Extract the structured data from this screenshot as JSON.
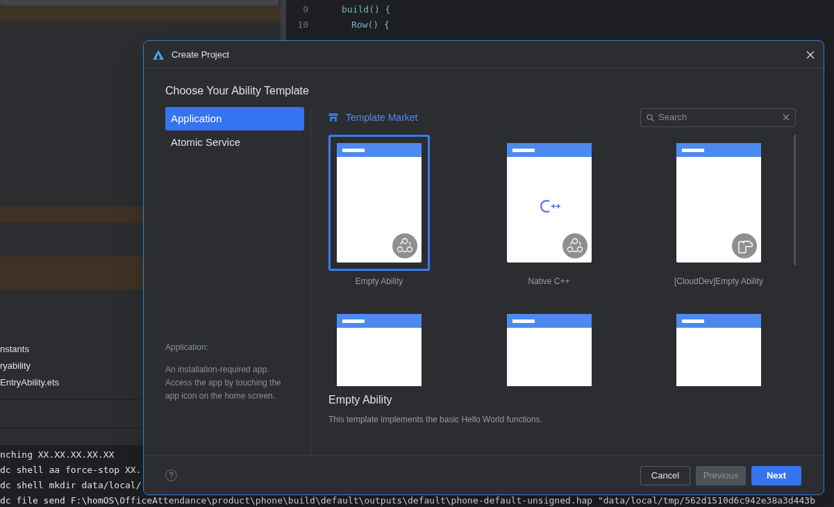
{
  "ide": {
    "editor_lines": [
      {
        "number": "9",
        "code": "build() {",
        "children": [
          {
            "number": "10",
            "code": "Row() {"
          }
        ]
      }
    ],
    "tree_items": [
      "nstants",
      "ryability",
      "EntryAbility.ets"
    ],
    "console_lines": [
      "nching XX.XX.XX.XX.XX",
      "dc shell aa force-stop XX.",
      "dc shell mkdir data/local/",
      "dc file send F:\\homOS\\OfficeAttendance\\product\\phone\\build\\default\\outputs\\default\\phone-default-unsigned.hap \"data/local/tmp/562d1510d6c942e38a3d443b"
    ]
  },
  "dialog": {
    "title": "Create Project",
    "heading": "Choose Your Ability Template",
    "categories": [
      {
        "label": "Application",
        "selected": true
      },
      {
        "label": "Atomic Service",
        "selected": false
      }
    ],
    "category_info": {
      "title": "Application:",
      "text": "An installation-required app. Access the app by touching the app icon on the home screen."
    },
    "market": {
      "label": "Template Market"
    },
    "search": {
      "placeholder": "Search"
    },
    "templates": [
      {
        "name": "Empty Ability",
        "kind": "ability",
        "selected": true
      },
      {
        "name": "Native C++",
        "kind": "cpp",
        "selected": false
      },
      {
        "name": "[CloudDev]Empty Ability",
        "kind": "cloud",
        "selected": false
      },
      {
        "kind": "blank",
        "selected": false
      },
      {
        "kind": "blank",
        "selected": false
      },
      {
        "kind": "blank",
        "selected": false
      }
    ],
    "detail": {
      "title": "Empty Ability",
      "text": "This template implements the basic Hello World functions."
    },
    "buttons": [
      {
        "label": "Cancel",
        "kind": "secondary",
        "disabled": false
      },
      {
        "label": "Previous",
        "kind": "secondary",
        "disabled": true
      },
      {
        "label": "Next",
        "kind": "primary",
        "disabled": false
      }
    ]
  }
}
